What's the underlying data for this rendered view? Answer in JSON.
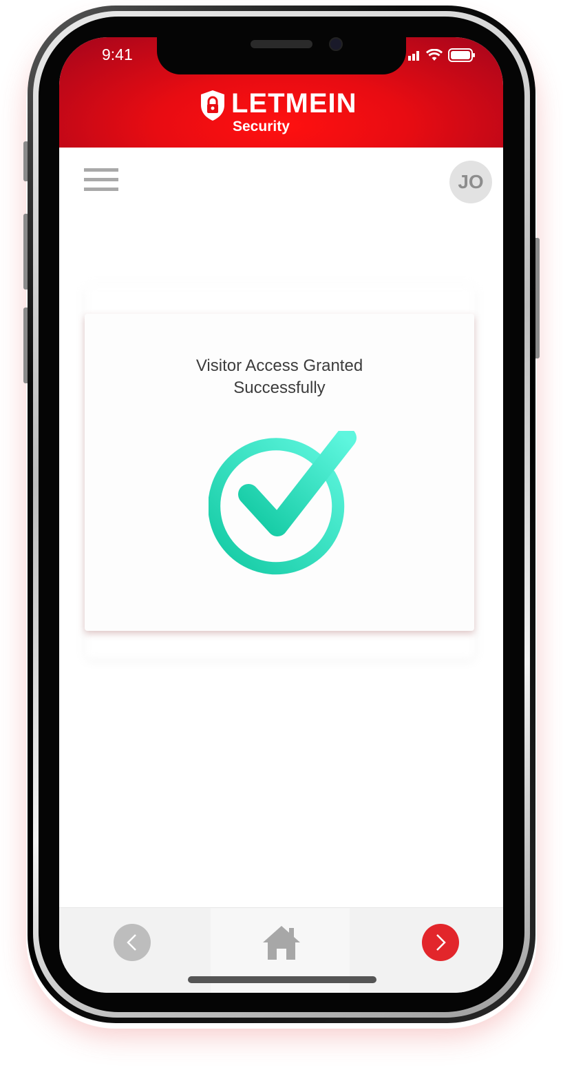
{
  "status_bar": {
    "time": "9:41"
  },
  "header": {
    "logo_word": "LETMEIN",
    "logo_sub": "Security",
    "background": "#e80c12"
  },
  "toolbar": {
    "menu_icon": "hamburger-menu-icon",
    "avatar_initials": "JO"
  },
  "dialog": {
    "message": "Visitor Access Granted Successfully",
    "icon": "check-circle-icon",
    "accent": "#2fd6b5"
  },
  "bottom_nav": {
    "back_icon": "chevron-left-icon",
    "home_icon": "home-icon",
    "next_icon": "chevron-right-icon",
    "back_color": "#bdbdbd",
    "next_color": "#e2262b"
  }
}
